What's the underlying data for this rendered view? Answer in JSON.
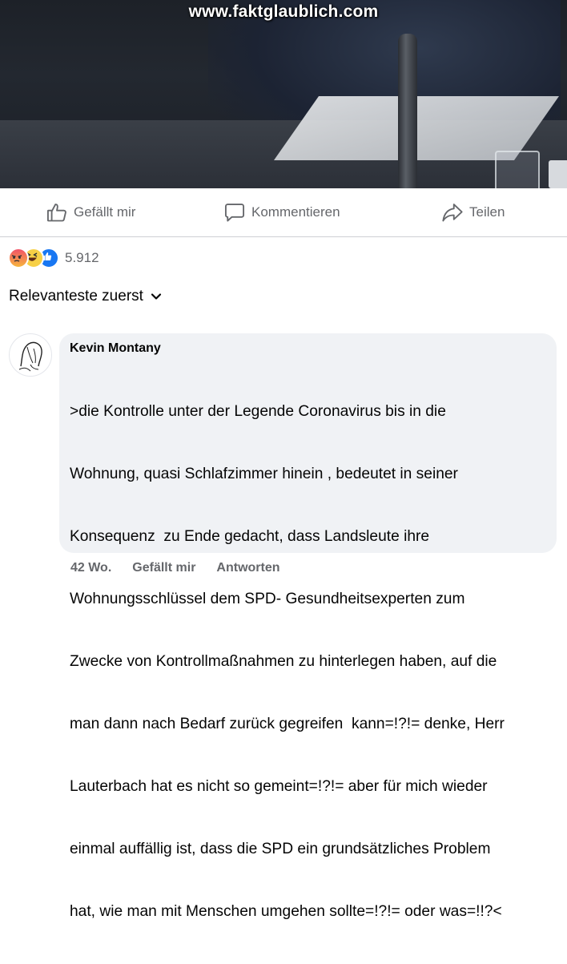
{
  "media": {
    "watermark": "www.faktglaublich.com"
  },
  "actions": {
    "like_label": "Gefällt mir",
    "comment_label": "Kommentieren",
    "share_label": "Teilen"
  },
  "reactions": {
    "icons": [
      "angry-reaction-icon",
      "haha-reaction-icon",
      "like-reaction-icon"
    ],
    "count": "5.912"
  },
  "sort": {
    "label": "Relevanteste zuerst"
  },
  "comment": {
    "author": "Kevin Montany",
    "lines": [
      ">die Kontrolle unter der Legende Coronavirus bis in die",
      "Wohnung, quasi Schlafzimmer hinein , bedeutet in seiner",
      "Konsequenz  zu Ende gedacht, dass Landsleute ihre",
      "Wohnungsschlüssel dem SPD- Gesundheitsexperten zum",
      "Zwecke von Kontrollmaßnahmen zu hinterlegen haben, auf die",
      "man dann nach Bedarf zurück gegreifen  kann=!?!= denke, Herr",
      "Lauterbach hat es nicht so gemeint=!?!= aber für mich wieder",
      "einmal auffällig ist, dass die SPD ein grundsätzliches Problem",
      "hat, wie man mit Menschen umgehen sollte=!?!= oder was=!!?<"
    ],
    "time": "42 Wo.",
    "like_label": "Gefällt mir",
    "reply_label": "Antworten"
  },
  "colors": {
    "secondary_text": "#65676b",
    "bubble_bg": "#f0f2f5",
    "like_blue": "#1877f2"
  }
}
